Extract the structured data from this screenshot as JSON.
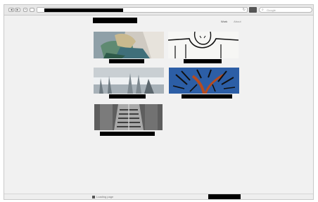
{
  "browser": {
    "back_glyph": "◀",
    "forward_glyph": "▶",
    "plus_glyph": "+",
    "reload_glyph": "↻",
    "search_placeholder": "Google"
  },
  "nav": {
    "items": [
      "Work",
      "About"
    ]
  },
  "status": {
    "text": "Loading page"
  },
  "colors": {
    "page_bg": "#f1f1f1",
    "toolbar_bg": "#e7e7e7",
    "redaction": "#000000"
  }
}
